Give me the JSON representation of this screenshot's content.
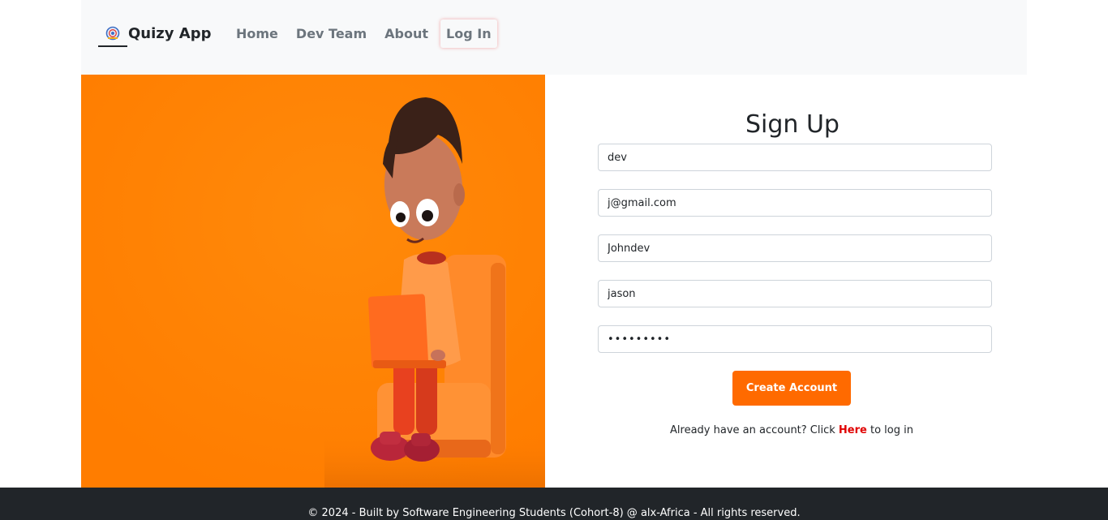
{
  "navbar": {
    "brand": {
      "name": "Quizy App",
      "logo_icon": "quiz-logo-icon"
    },
    "links": [
      {
        "label": "Home"
      },
      {
        "label": "Dev Team"
      },
      {
        "label": "About"
      },
      {
        "label": "Log In"
      }
    ]
  },
  "hero": {
    "background_color": "#ff8000",
    "illustration": "boy-with-laptop-illustration"
  },
  "form": {
    "title": "Sign Up",
    "fields": [
      {
        "value": "dev",
        "type": "text"
      },
      {
        "value": "j@gmail.com",
        "type": "email"
      },
      {
        "value": "Johndev",
        "type": "text"
      },
      {
        "value": "jason",
        "type": "text"
      },
      {
        "value": "•••••••••",
        "type": "password"
      }
    ],
    "submit_label": "Create Account",
    "login_hint": {
      "prefix": "Already have an account? Click ",
      "link": "Here",
      "suffix": " to log in"
    }
  },
  "footer": {
    "text": "© 2024 - Built by Software Engineering Students (Cohort-8) @ alx-Africa - All rights reserved."
  },
  "colors": {
    "accent": "#ff6a00",
    "navbar_bg": "#f8f9fa",
    "footer_bg": "#212529",
    "link_red": "#e00000"
  }
}
